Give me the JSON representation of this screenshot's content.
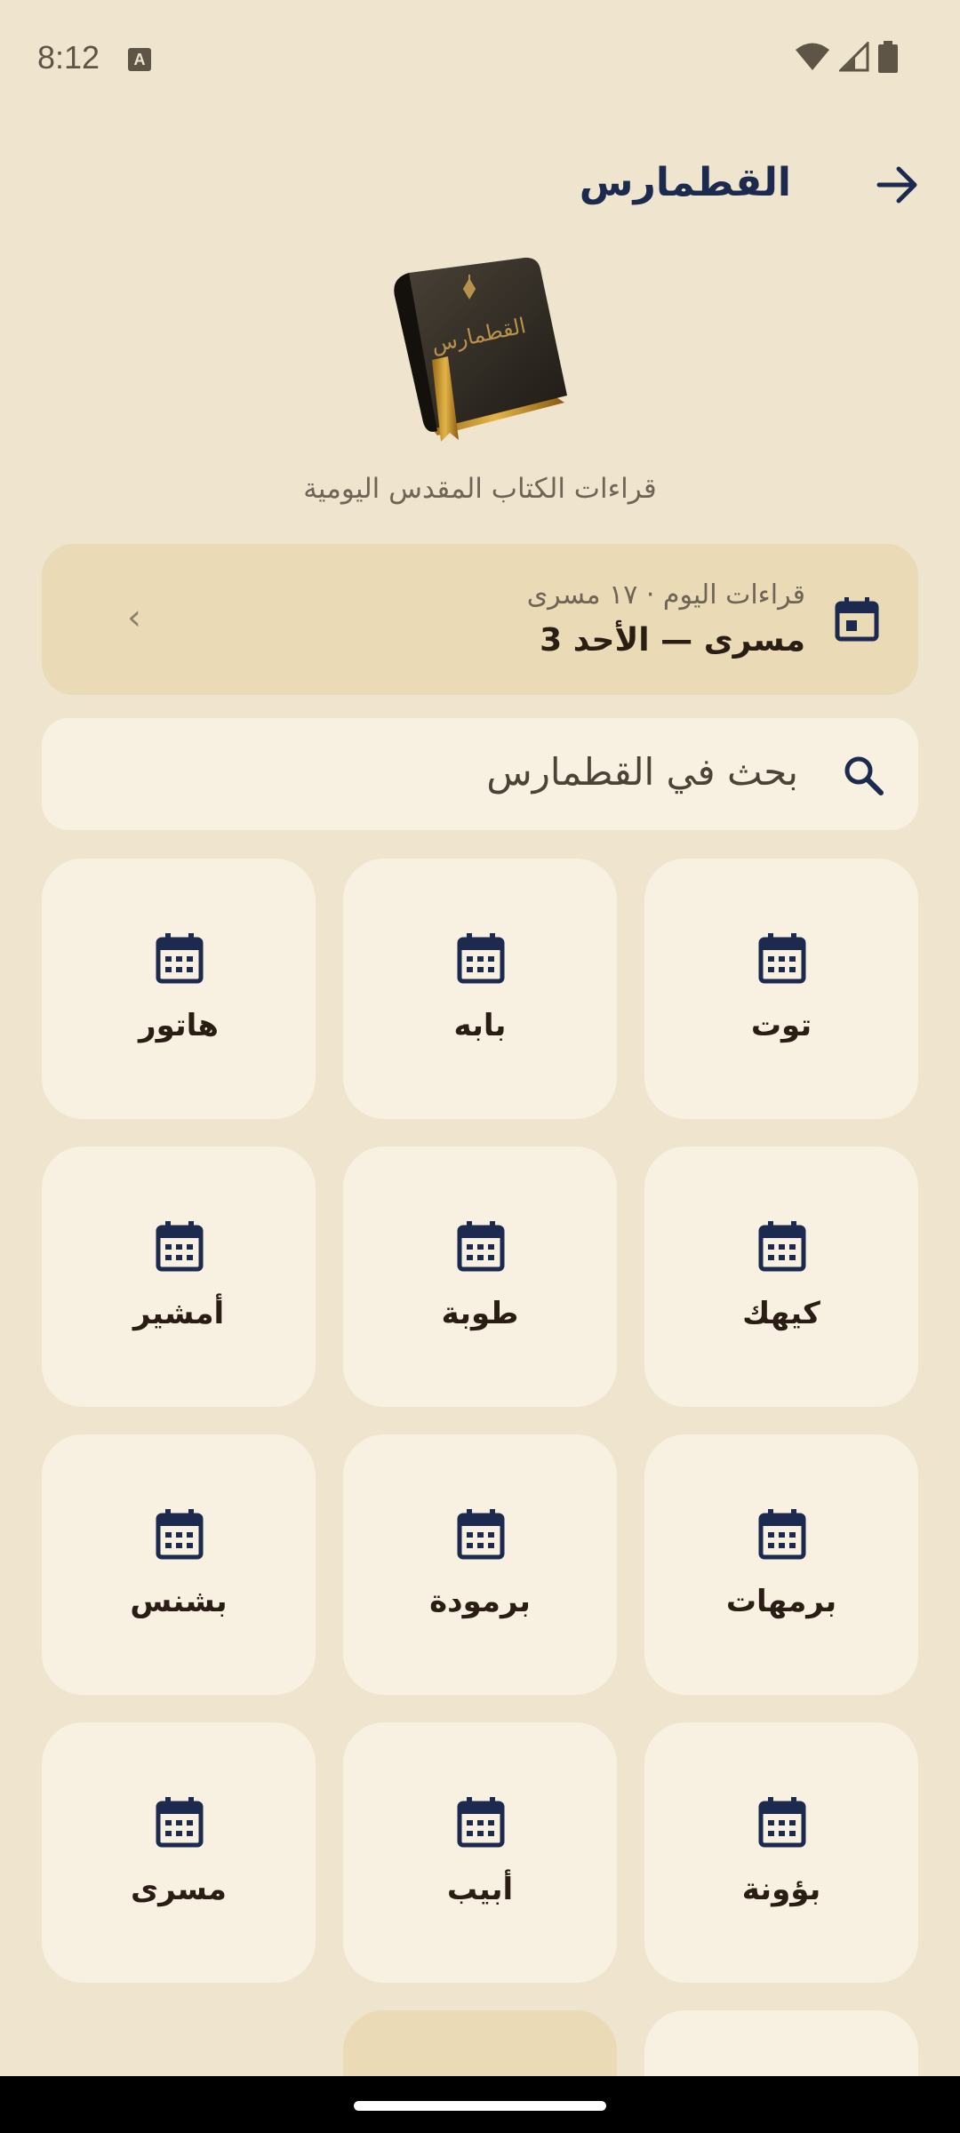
{
  "status_bar": {
    "time": "8:12",
    "keyboard_badge": "A",
    "icons": [
      "wifi-icon",
      "signal-icon",
      "battery-icon"
    ]
  },
  "header": {
    "title": "القطمارس",
    "arrow_icon": "arrow-right-icon"
  },
  "book": {
    "cover_text": "القطمارس"
  },
  "subtitle": "قراءات الكتاب المقدس اليومية",
  "today_card": {
    "label": "قراءات اليوم · ١٧ مسرى",
    "title": "مسرى — الأحد 3",
    "icon": "calendar-today-icon",
    "chevron": "‹"
  },
  "search": {
    "placeholder": "بحث في القطمارس",
    "icon": "search-icon"
  },
  "months": [
    {
      "label": "توت"
    },
    {
      "label": "بابه"
    },
    {
      "label": "هاتور"
    },
    {
      "label": "كيهك"
    },
    {
      "label": "طوبة"
    },
    {
      "label": "أمشير"
    },
    {
      "label": "برمهات"
    },
    {
      "label": "برمودة"
    },
    {
      "label": "بشنس"
    },
    {
      "label": "بؤونة"
    },
    {
      "label": "أبيب"
    },
    {
      "label": "مسرى"
    }
  ],
  "colors": {
    "background": "#EFE4CD",
    "tile": "#F8F0E1",
    "highlight": "#EADAB6",
    "accent_navy": "#1D2A4F"
  }
}
